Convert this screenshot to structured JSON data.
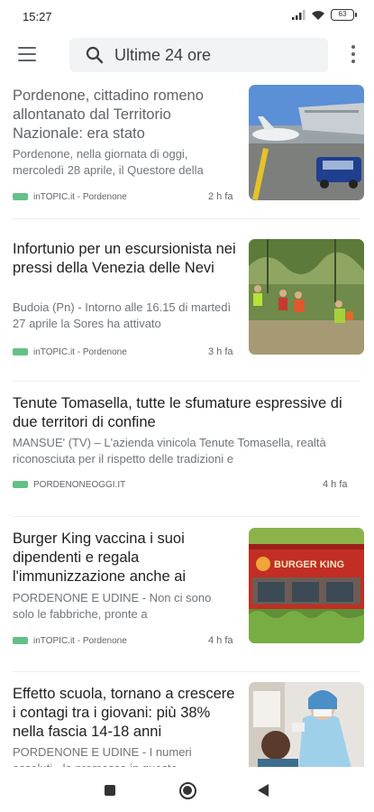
{
  "status_bar": {
    "time": "15:27",
    "battery": "63"
  },
  "header": {
    "search_text": "Ultime 24 ore"
  },
  "articles": [
    {
      "title": "Pordenone, cittadino romeno allontanato dal Territorio Nazionale: era stato",
      "snippet": "Pordenone, nella giornata di oggi, mercoledì 28 aprile, il Questore della",
      "source": "inTOPIC.it - Pordenone",
      "time": "2 h fa",
      "image": "airport-police-photo"
    },
    {
      "title": "Infortunio per un escursionista nei pressi della Venezia delle Nevi",
      "snippet": "Budoia (Pn) - Intorno alle 16.15 di martedì 27 aprile la Sores ha attivato",
      "source": "inTOPIC.it - Pordenone",
      "time": "3 h fa",
      "image": "mountain-rescue-photo"
    },
    {
      "title": "Tenute Tomasella, tutte le sfumature espressive di due territori di confine",
      "snippet": "MANSUE' (TV) – L'azienda vinicola Tenute Tomasella, realtà riconosciuta per il rispetto delle tradizioni e",
      "source": "PORDENONEOGGI.IT",
      "time": "4 h fa"
    },
    {
      "title": "Burger King vaccina i suoi dipendenti e regala l'immunizzazione anche ai",
      "snippet": "PORDENONE E UDINE - Non ci sono solo le fabbriche, pronte a",
      "source": "inTOPIC.it - Pordenone",
      "time": "4 h fa",
      "image": "burger-king-store-photo",
      "image_sign": "BURGER KING"
    },
    {
      "title": "Effetto scuola, tornano a crescere i contagi tra i giovani: più 38% nella fascia 14-18 anni",
      "snippet": "PORDENONE E UDINE - I numeri assoluti - la promessa in questo",
      "time": "",
      "image": "covid-test-photo"
    }
  ],
  "colors": {
    "source_badge": "#64c087",
    "search_bg": "#f1f3f4"
  },
  "icons": {
    "menu": "hamburger-menu-icon",
    "search": "search-icon",
    "more": "more-vert-icon",
    "nav_recents": "square-icon",
    "nav_home": "circle-icon",
    "nav_back": "triangle-back-icon"
  }
}
